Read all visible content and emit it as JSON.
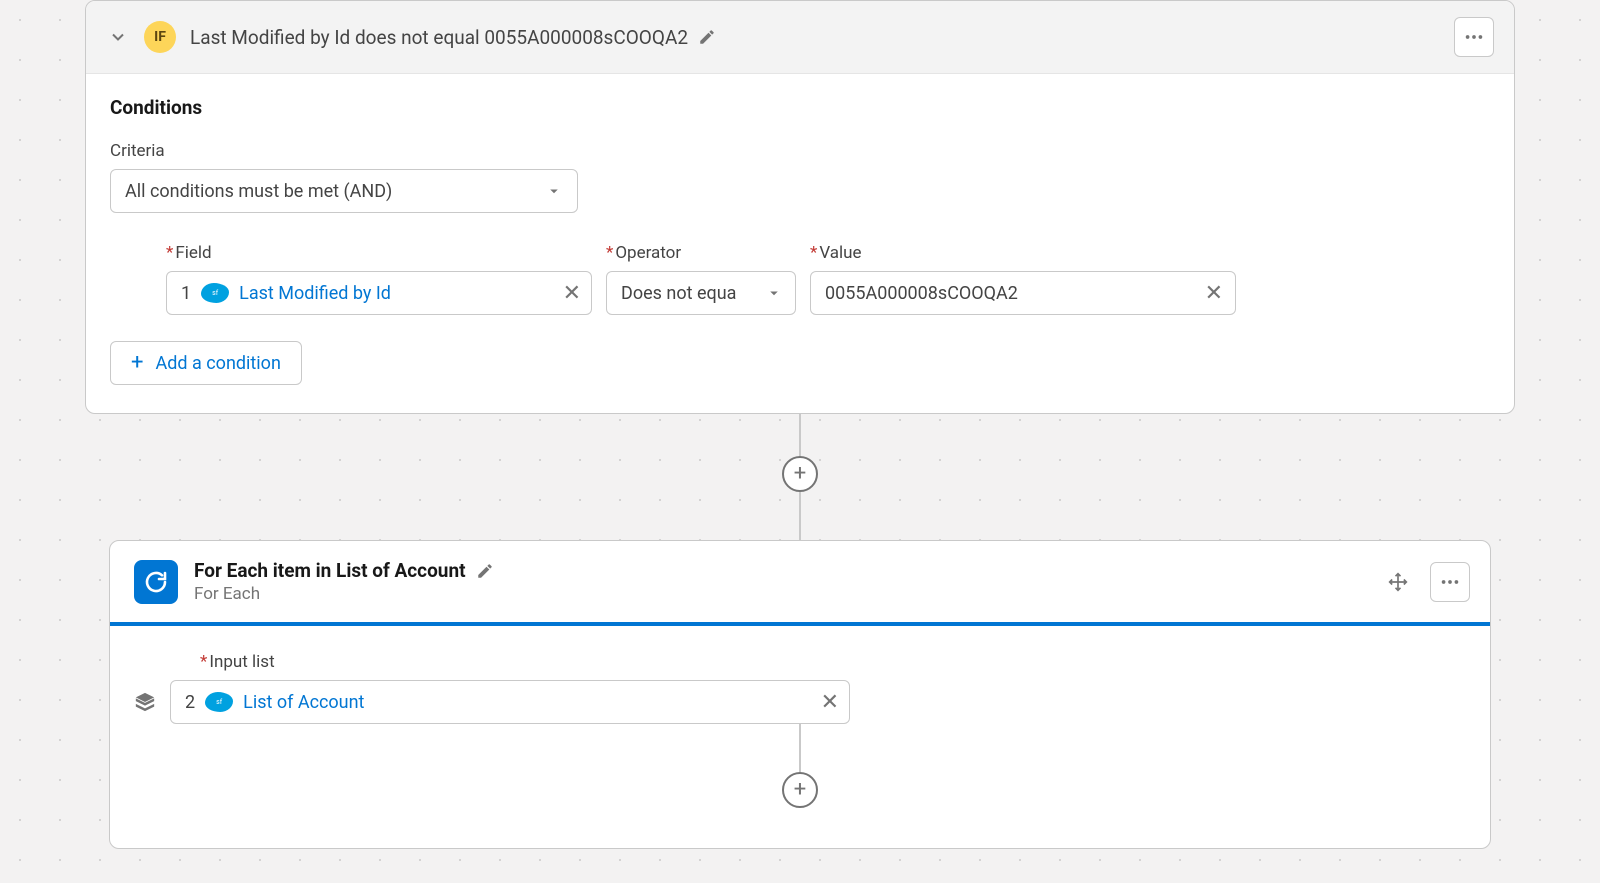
{
  "if_block": {
    "badge": "IF",
    "title": "Last Modified by Id does not equal 0055A000008sCOOQA2",
    "conditions_heading": "Conditions",
    "criteria_label": "Criteria",
    "criteria_value": "All conditions must be met (AND)",
    "row": {
      "field_label": "Field",
      "operator_label": "Operator",
      "value_label": "Value",
      "field_number": "1",
      "field_value": "Last Modified by Id",
      "operator_value": "Does not equa",
      "value_value": "0055A000008sCOOQA2"
    },
    "add_condition_label": "Add a condition"
  },
  "foreach_block": {
    "title": "For Each item in List of Account",
    "subtitle": "For Each",
    "input_list_label": "Input list",
    "input_list_number": "2",
    "input_list_value": "List of Account"
  }
}
